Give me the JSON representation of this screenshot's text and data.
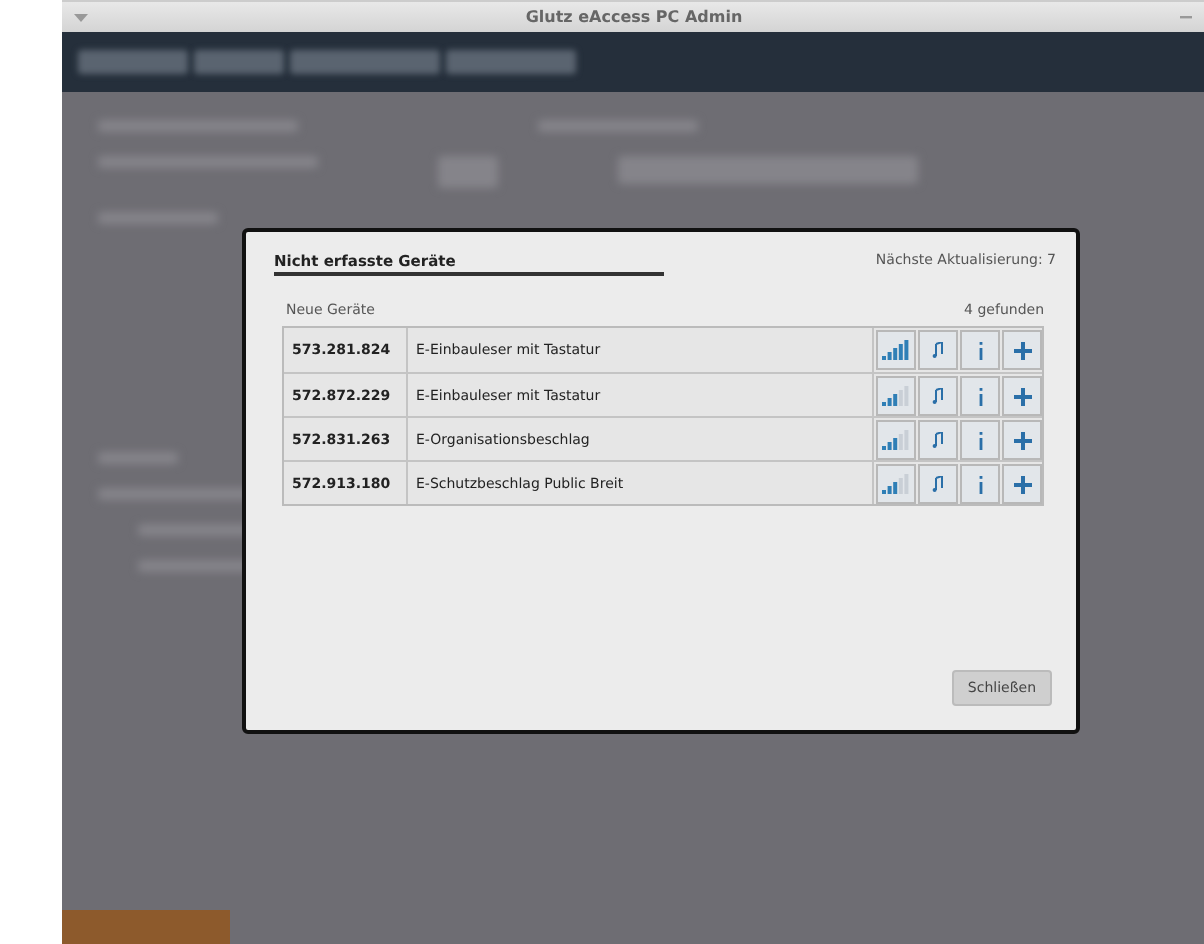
{
  "window": {
    "title": "Glutz eAccess PC Admin"
  },
  "dialog": {
    "title": "Nicht erfasste Geräte",
    "refresh": "Nächste Aktualisierung: 7",
    "section": "Neue Geräte",
    "count": "4 gefunden",
    "devices": [
      {
        "serial": "573.281.824",
        "name": "E-Einbauleser mit Tastatur",
        "strong_signal": true
      },
      {
        "serial": "572.872.229",
        "name": "E-Einbauleser mit Tastatur",
        "strong_signal": false
      },
      {
        "serial": "572.831.263",
        "name": "E-Organisationsbeschlag",
        "strong_signal": false
      },
      {
        "serial": "572.913.180",
        "name": "E-Schutzbeschlag Public Breit",
        "strong_signal": false
      }
    ],
    "close_button": "Schließen"
  }
}
